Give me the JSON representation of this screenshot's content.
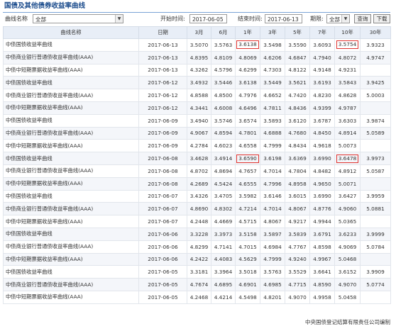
{
  "page": {
    "title": "国债及其他债券收益率曲线"
  },
  "filter": {
    "curve_label": "曲线名称",
    "curve_value": "全部",
    "start_label": "开始时间:",
    "start_value": "2017-06-05",
    "end_label": "结束时间:",
    "end_value": "2017-06-13",
    "term_label": "期限:",
    "term_value": "全部",
    "query_button": "查询",
    "download_button": "下载"
  },
  "table": {
    "headers": [
      "曲线名称",
      "日期",
      "3月",
      "6月",
      "1年",
      "3年",
      "5年",
      "7年",
      "10年",
      "30年"
    ],
    "highlight_color": "#e0322e",
    "rows": [
      [
        "中债国债收益率曲线",
        "2017-06-13",
        "3.5070",
        "3.5763",
        "3.6138",
        "3.5498",
        "3.5590",
        "3.6093",
        "3.5754",
        "3.9323"
      ],
      [
        "中债商业银行普通债收益率曲线(AAA)",
        "2017-06-13",
        "4.8395",
        "4.8109",
        "4.8069",
        "4.6206",
        "4.6847",
        "4.7940",
        "4.8072",
        "4.9747"
      ],
      [
        "中债中短期票据收益率曲线(AAA)",
        "2017-06-13",
        "4.3262",
        "4.5796",
        "4.6299",
        "4.7303",
        "4.8122",
        "4.9148",
        "4.9231",
        ""
      ],
      [
        "中债国债收益率曲线",
        "2017-06-12",
        "3.4932",
        "3.5446",
        "3.6138",
        "3.5449",
        "3.5621",
        "3.6193",
        "3.5843",
        "3.9425"
      ],
      [
        "中债商业银行普通债收益率曲线(AAA)",
        "2017-06-12",
        "4.8588",
        "4.8500",
        "4.7976",
        "4.6652",
        "4.7420",
        "4.8230",
        "4.8628",
        "5.0003"
      ],
      [
        "中债中短期票据收益率曲线(AAA)",
        "2017-06-12",
        "4.3441",
        "4.6008",
        "4.6496",
        "4.7811",
        "4.8436",
        "4.9399",
        "4.9787",
        ""
      ],
      [
        "中债国债收益率曲线",
        "2017-06-09",
        "3.4940",
        "3.5746",
        "3.6574",
        "3.5893",
        "3.6120",
        "3.6787",
        "3.6303",
        "3.9874"
      ],
      [
        "中债商业银行普通债收益率曲线(AAA)",
        "2017-06-09",
        "4.9067",
        "4.8594",
        "4.7801",
        "4.6888",
        "4.7680",
        "4.8450",
        "4.8914",
        "5.0589"
      ],
      [
        "中债中短期票据收益率曲线(AAA)",
        "2017-06-09",
        "4.2784",
        "4.6023",
        "4.6558",
        "4.7999",
        "4.8434",
        "4.9618",
        "5.0073",
        ""
      ],
      [
        "中债国债收益率曲线",
        "2017-06-08",
        "3.4628",
        "3.4914",
        "3.6590",
        "3.6198",
        "3.6369",
        "3.6990",
        "3.6478",
        "3.9973"
      ],
      [
        "中债商业银行普通债收益率曲线(AAA)",
        "2017-06-08",
        "4.8702",
        "4.8694",
        "4.7657",
        "4.7014",
        "4.7804",
        "4.8482",
        "4.8912",
        "5.0587"
      ],
      [
        "中债中短期票据收益率曲线(AAA)",
        "2017-06-08",
        "4.2689",
        "4.5424",
        "4.6555",
        "4.7996",
        "4.8958",
        "4.9650",
        "5.0071",
        ""
      ],
      [
        "中债国债收益率曲线",
        "2017-06-07",
        "3.4326",
        "3.4705",
        "3.5982",
        "3.6146",
        "3.6015",
        "3.6990",
        "3.6427",
        "3.9959"
      ],
      [
        "中债商业银行普通债收益率曲线(AAA)",
        "2017-06-07",
        "4.8690",
        "4.8302",
        "4.7214",
        "4.7014",
        "4.8067",
        "4.8776",
        "4.9060",
        "5.0881"
      ],
      [
        "中债中短期票据收益率曲线(AAA)",
        "2017-06-07",
        "4.2448",
        "4.4669",
        "4.5715",
        "4.8067",
        "4.9217",
        "4.9944",
        "5.0365",
        ""
      ],
      [
        "中债国债收益率曲线",
        "2017-06-06",
        "3.3228",
        "3.3973",
        "3.5158",
        "3.5897",
        "3.5839",
        "3.6791",
        "3.6233",
        "3.9999"
      ],
      [
        "中债商业银行普通债收益率曲线(AAA)",
        "2017-06-06",
        "4.8299",
        "4.7141",
        "4.7015",
        "4.6984",
        "4.7767",
        "4.8598",
        "4.9069",
        "5.0784"
      ],
      [
        "中债中短期票据收益率曲线(AAA)",
        "2017-06-06",
        "4.2422",
        "4.4083",
        "4.5629",
        "4.7999",
        "4.9240",
        "4.9967",
        "5.0468",
        ""
      ],
      [
        "中债国债收益率曲线",
        "2017-06-05",
        "3.3181",
        "3.3964",
        "3.5018",
        "3.5763",
        "3.5529",
        "3.6641",
        "3.6152",
        "3.9909"
      ],
      [
        "中债商业银行普通债收益率曲线(AAA)",
        "2017-06-05",
        "4.7674",
        "4.6895",
        "4.6901",
        "4.6985",
        "4.7715",
        "4.8590",
        "4.9070",
        "5.0774"
      ],
      [
        "中债中短期票据收益率曲线(AAA)",
        "2017-06-05",
        "4.2468",
        "4.4214",
        "4.5498",
        "4.8201",
        "4.9070",
        "4.9958",
        "5.0458",
        ""
      ]
    ],
    "highlights": [
      {
        "row": 0,
        "col": 4
      },
      {
        "row": 0,
        "col": 8
      },
      {
        "row": 9,
        "col": 4
      },
      {
        "row": 9,
        "col": 8
      }
    ]
  },
  "footer": {
    "text": "中央国债登记结算有限责任公司编制"
  }
}
